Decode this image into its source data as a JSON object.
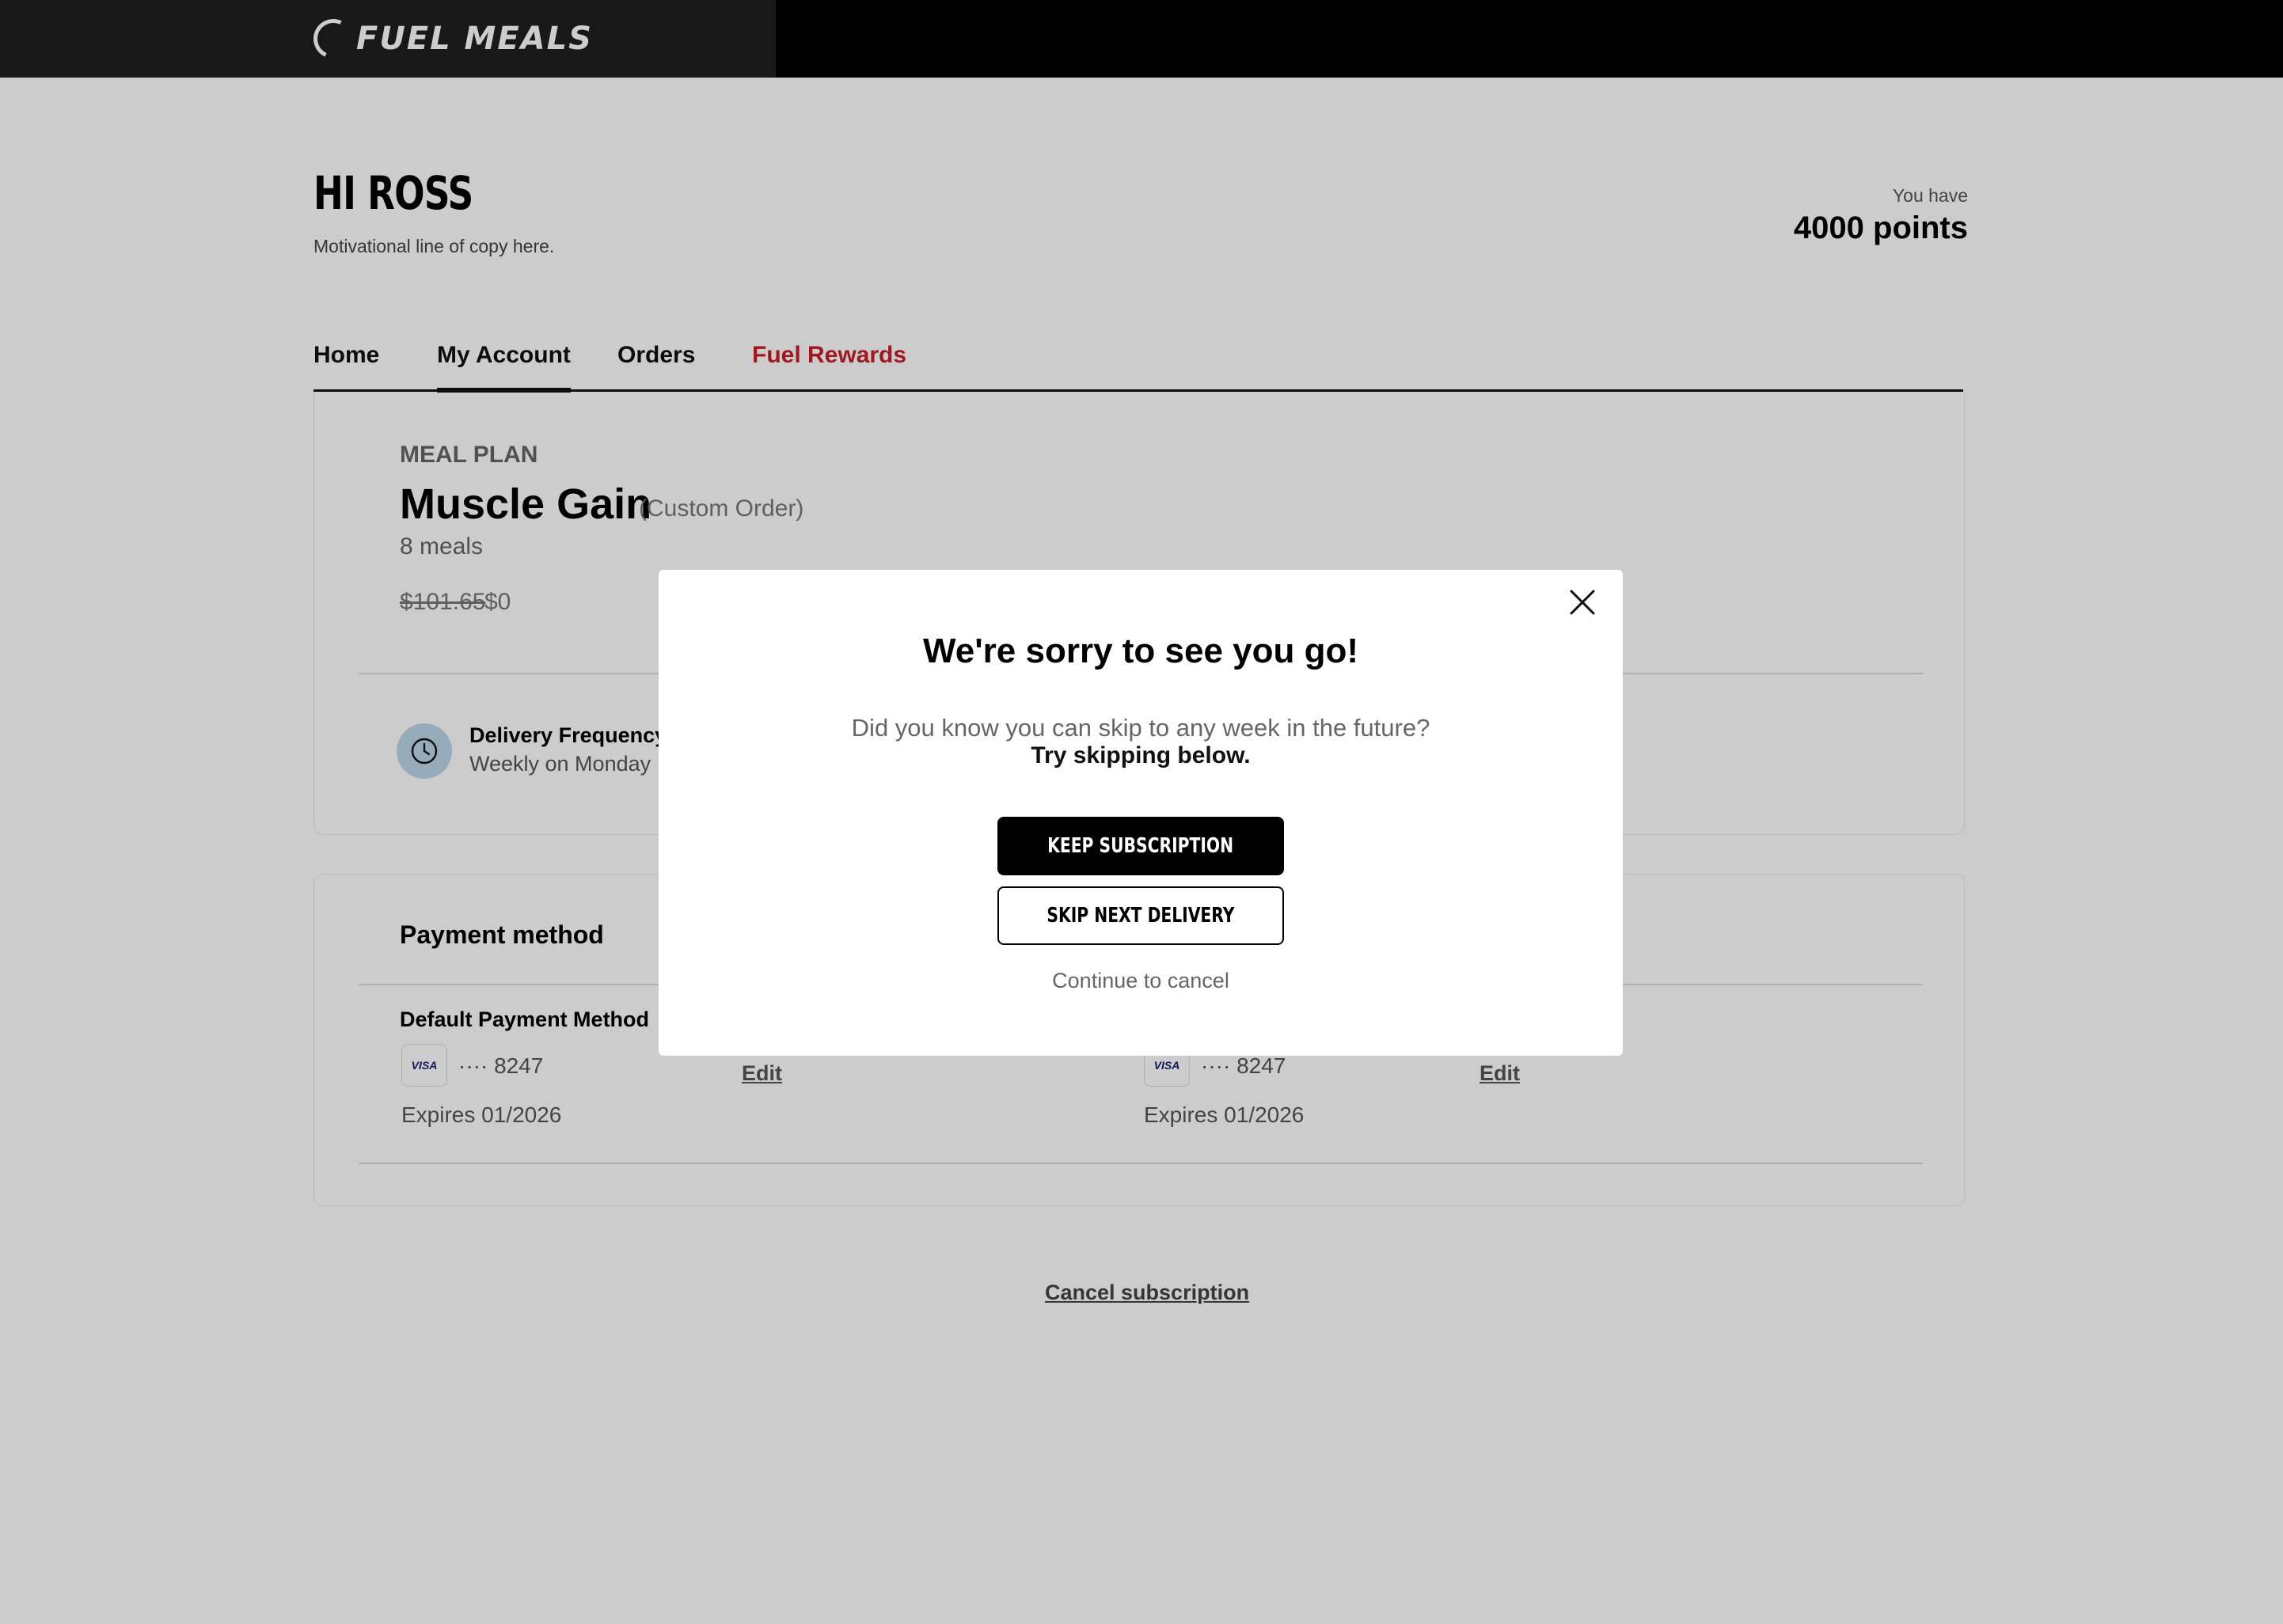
{
  "header": {
    "logo_text": "FUEL MEALS"
  },
  "profile": {
    "greeting": "HI ROSS",
    "motto": "Motivational line of copy here.",
    "points_label": "You have",
    "points_value": "4000 points"
  },
  "tabs": [
    {
      "label": "Home"
    },
    {
      "label": "My Account",
      "active": true
    },
    {
      "label": "Orders"
    },
    {
      "label": "Fuel Rewards"
    }
  ],
  "meal_plan": {
    "kicker": "MEAL PLAN",
    "name": "Muscle Gain",
    "note": "(Custom Order)",
    "meals": "8 meals",
    "price_old": "$101.65",
    "price_new": "$0",
    "frequency_label": "Delivery Frequency",
    "frequency_value": "Weekly on Monday"
  },
  "payment": {
    "title": "Payment method",
    "default_label": "Default Payment Method",
    "cards": [
      {
        "brand": "VISA",
        "number": "···· 8247",
        "expires": "Expires 01/2026",
        "edit": "Edit"
      },
      {
        "brand": "VISA",
        "number": "···· 8247",
        "expires": "Expires 01/2026",
        "edit": "Edit"
      }
    ]
  },
  "cancel_subscription": "Cancel subscription",
  "modal": {
    "title": "We're sorry to see you go!",
    "text": "Did you know you can skip to any week in the future?",
    "strong": "Try skipping below.",
    "keep_label": "KEEP SUBSCRIPTION",
    "skip_label": "SKIP NEXT DELIVERY",
    "continue_label": "Continue to cancel"
  },
  "colors": {
    "accent": "#c8202a",
    "clock_bg": "#bcd8ea",
    "overlay": "rgba(0,0,0,0.2)"
  },
  "icons": {
    "close": "close-icon",
    "clock": "clock-icon"
  }
}
